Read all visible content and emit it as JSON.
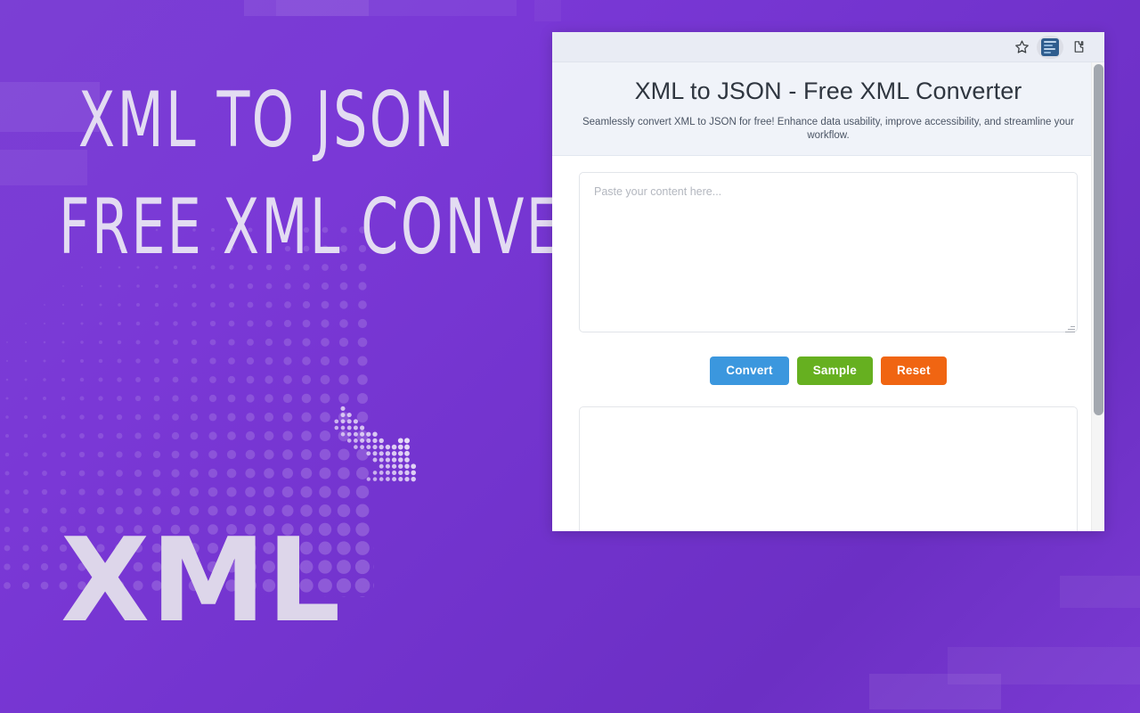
{
  "banner": {
    "headline_line1": "XML TO JSON",
    "headline_line2": "FREE XML CONVERTER",
    "watermark": "XML",
    "accent_color": "#7b3fd4",
    "headline_color": "#e3dcf2"
  },
  "browser": {
    "toolbar": {
      "bookmark_icon": "star-icon",
      "extension_icon": "extension-app-icon",
      "extensions_puzzle_icon": "extensions-puzzle-icon"
    }
  },
  "page": {
    "title": "XML to JSON - Free XML Converter",
    "subtitle": "Seamlessly convert XML to JSON for free! Enhance data usability, improve accessibility, and streamline your workflow.",
    "input": {
      "placeholder": "Paste your content here...",
      "value": ""
    },
    "buttons": {
      "convert": {
        "label": "Convert",
        "color": "#3b97de"
      },
      "sample": {
        "label": "Sample",
        "color": "#66b020"
      },
      "reset": {
        "label": "Reset",
        "color": "#f06512"
      }
    },
    "output": {
      "value": ""
    }
  }
}
